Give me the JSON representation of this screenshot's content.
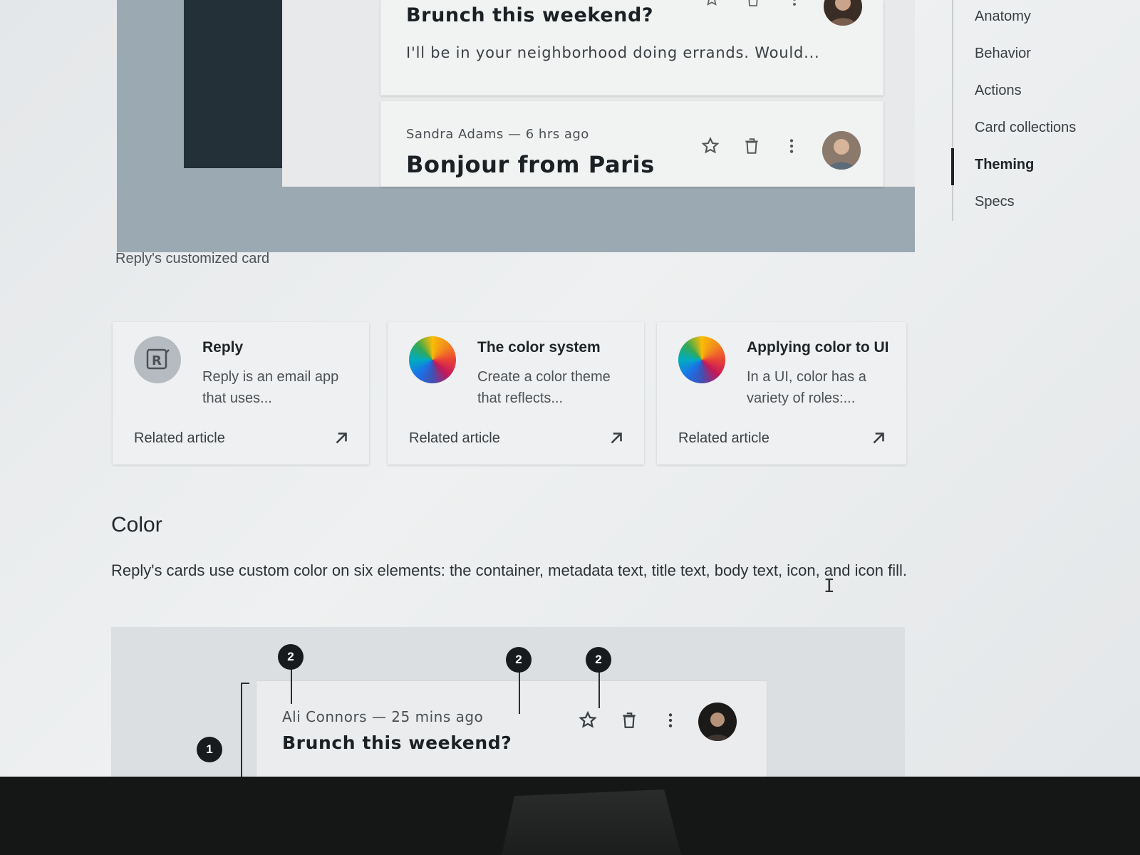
{
  "demo": {
    "card1": {
      "title": "Brunch this weekend?",
      "body": "I'll be in your neighborhood doing errands. Would..."
    },
    "card2": {
      "meta": "Sandra Adams — 6 hrs ago",
      "title": "Bonjour from Paris"
    },
    "caption": "Reply's customized card"
  },
  "nav": {
    "items": [
      {
        "label": "Anatomy"
      },
      {
        "label": "Behavior"
      },
      {
        "label": "Actions"
      },
      {
        "label": "Card collections"
      },
      {
        "label": "Theming"
      },
      {
        "label": "Specs"
      }
    ],
    "active": "Theming"
  },
  "articles": [
    {
      "title": "Reply",
      "description": "Reply is an email app that uses...",
      "link": "Related article",
      "icon": "reply-logo-icon"
    },
    {
      "title": "The color system",
      "description": "Create a color theme that reflects...",
      "link": "Related article",
      "icon": "color-wheel-icon"
    },
    {
      "title": "Applying color to UI",
      "description": "In a UI, color has a variety of roles:...",
      "link": "Related article",
      "icon": "color-wheel-icon"
    }
  ],
  "color_section": {
    "heading": "Color",
    "text": "Reply's cards use custom color on six elements: the container, metadata text, title text, body text, icon, and icon fill."
  },
  "spec": {
    "meta": "Ali Connors — 25 mins ago",
    "title": "Brunch this weekend?",
    "markers": [
      "2",
      "2",
      "2",
      "1"
    ]
  },
  "colors": {
    "dark_bar": "#233038",
    "figure_bg": "#9aa9b2",
    "marker": "#171b1e"
  }
}
